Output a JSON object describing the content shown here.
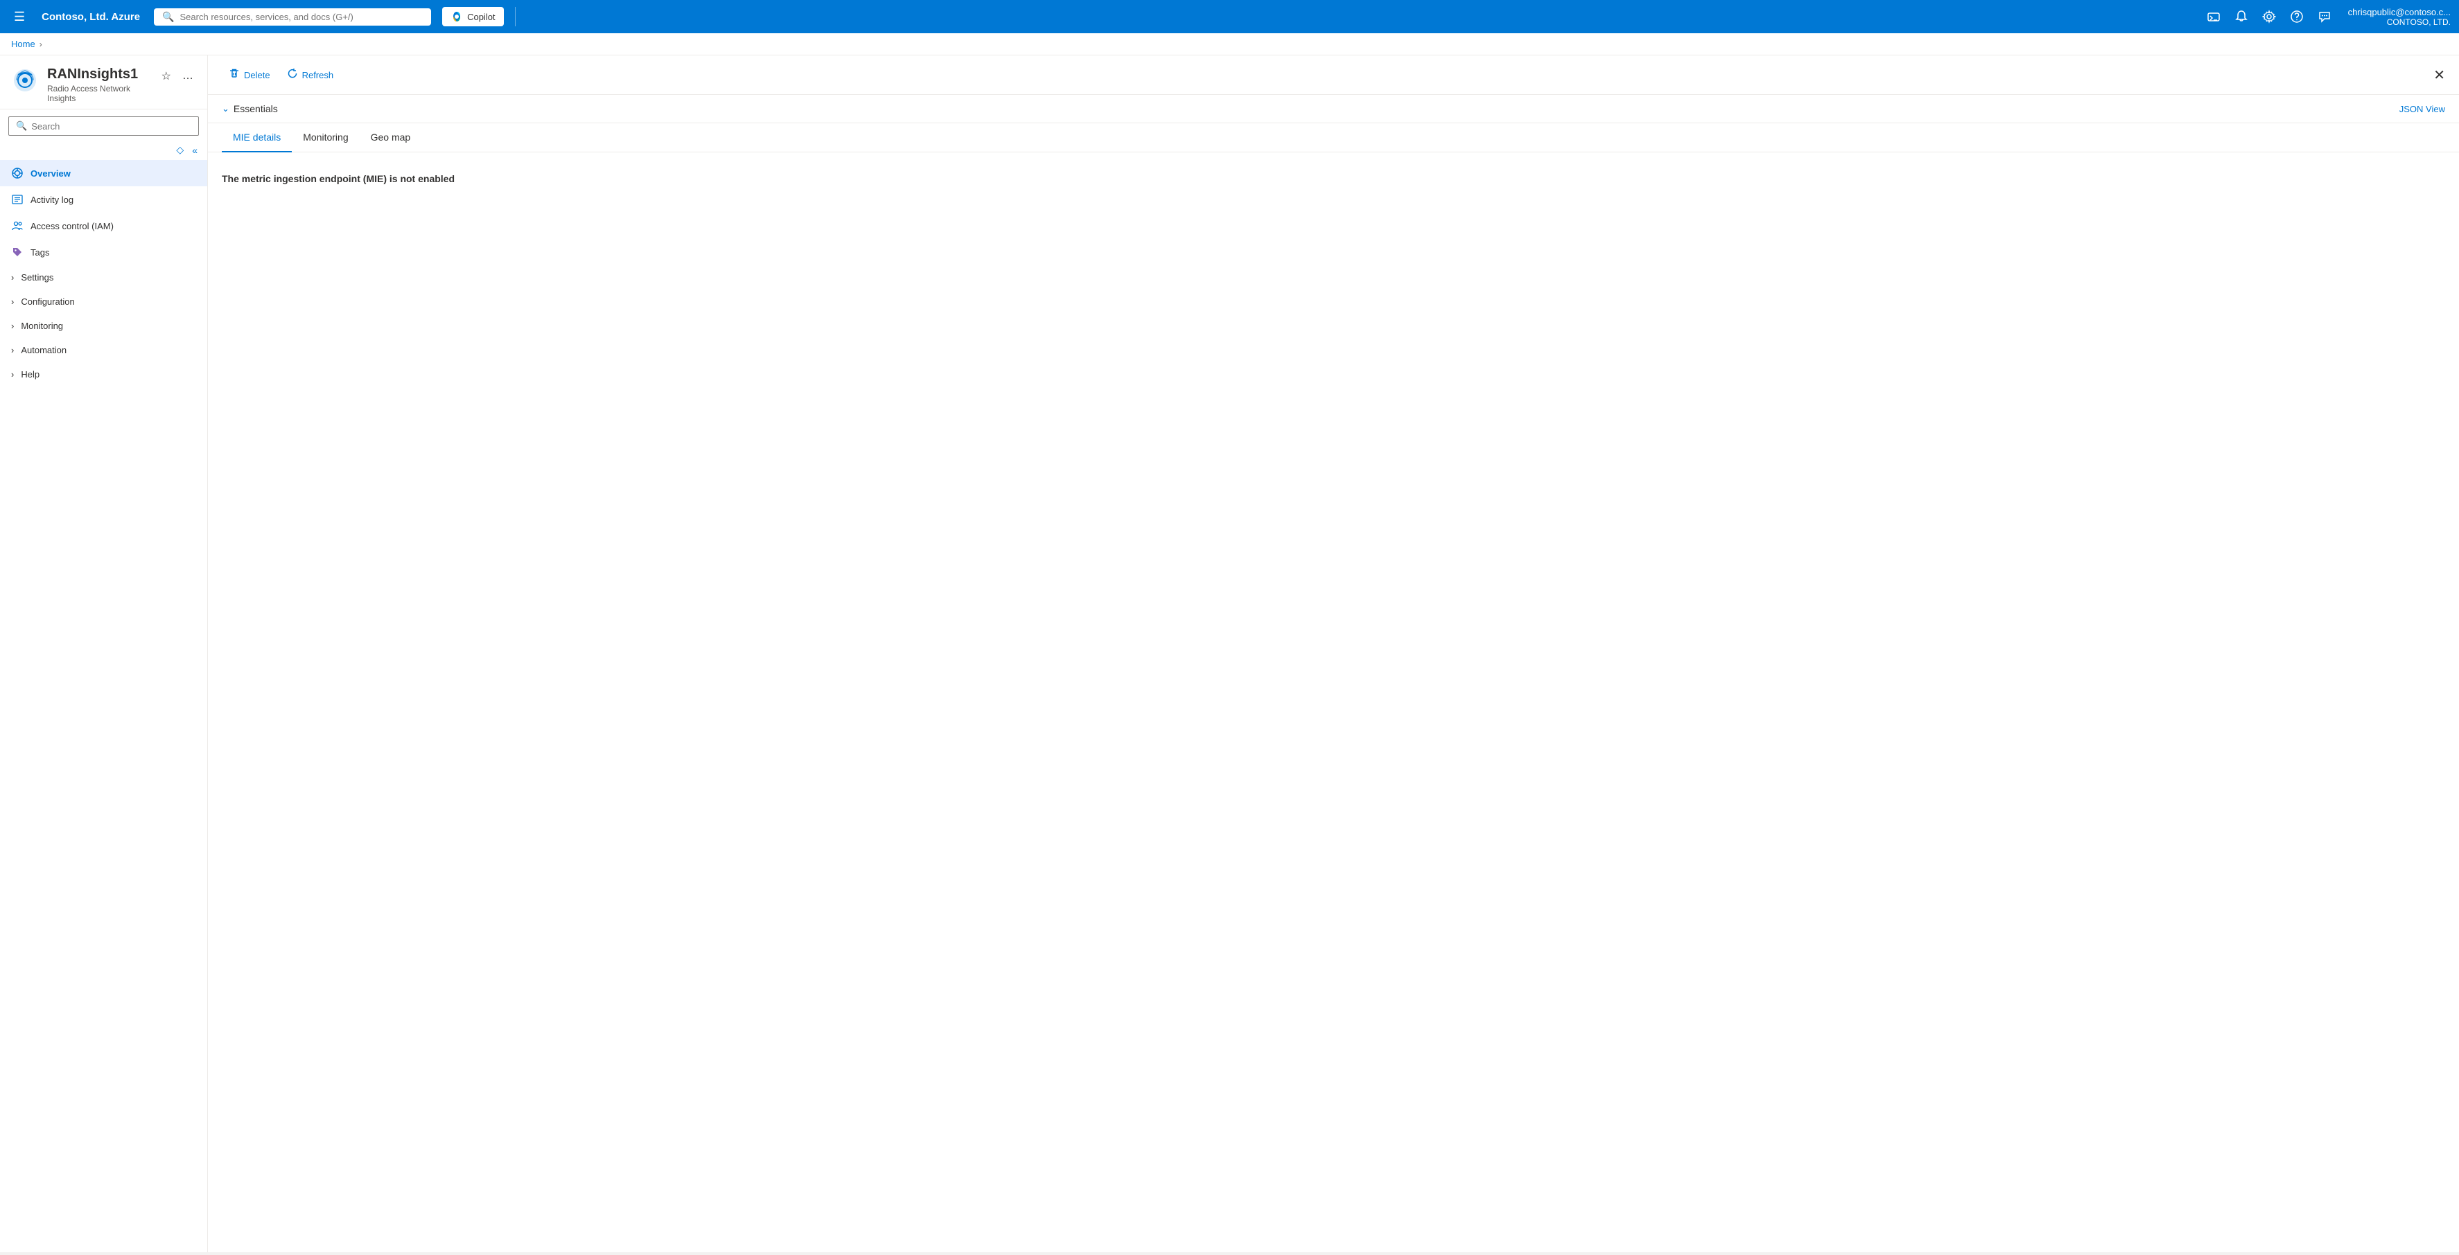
{
  "topnav": {
    "brand": "Contoso, Ltd. Azure",
    "search_placeholder": "Search resources, services, and docs (G+/)",
    "copilot_label": "Copilot",
    "user_name": "chrisqpublic@contoso.c...",
    "user_tenant": "CONTOSO, LTD."
  },
  "breadcrumb": {
    "home": "Home"
  },
  "resource": {
    "title": "RANInsights1",
    "subtitle": "Radio Access Network Insights"
  },
  "sidebar_search": {
    "placeholder": "Search"
  },
  "nav_items": [
    {
      "id": "overview",
      "label": "Overview",
      "icon": "grid",
      "active": true,
      "hasChevron": false
    },
    {
      "id": "activity-log",
      "label": "Activity log",
      "icon": "list",
      "active": false,
      "hasChevron": false
    },
    {
      "id": "access-control",
      "label": "Access control (IAM)",
      "icon": "people",
      "active": false,
      "hasChevron": false
    },
    {
      "id": "tags",
      "label": "Tags",
      "icon": "tag",
      "active": false,
      "hasChevron": false
    },
    {
      "id": "settings",
      "label": "Settings",
      "icon": null,
      "active": false,
      "hasChevron": true
    },
    {
      "id": "configuration",
      "label": "Configuration",
      "icon": null,
      "active": false,
      "hasChevron": true
    },
    {
      "id": "monitoring",
      "label": "Monitoring",
      "icon": null,
      "active": false,
      "hasChevron": true
    },
    {
      "id": "automation",
      "label": "Automation",
      "icon": null,
      "active": false,
      "hasChevron": true
    },
    {
      "id": "help",
      "label": "Help",
      "icon": null,
      "active": false,
      "hasChevron": true
    }
  ],
  "toolbar": {
    "delete_label": "Delete",
    "refresh_label": "Refresh"
  },
  "essentials": {
    "title": "Essentials",
    "json_view": "JSON View"
  },
  "tabs": [
    {
      "id": "mie-details",
      "label": "MIE details",
      "active": true
    },
    {
      "id": "monitoring",
      "label": "Monitoring",
      "active": false
    },
    {
      "id": "geo-map",
      "label": "Geo map",
      "active": false
    }
  ],
  "content": {
    "mie_message": "The metric ingestion endpoint (MIE) is not enabled"
  }
}
